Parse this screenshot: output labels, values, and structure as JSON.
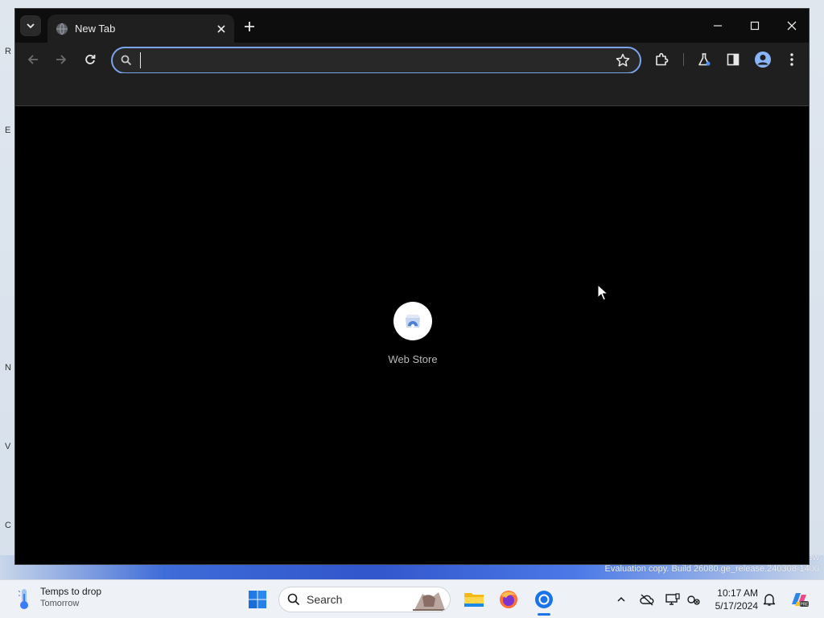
{
  "browser": {
    "tab": {
      "title": "New Tab"
    },
    "omnibox": {
      "value": "",
      "placeholder": ""
    },
    "shortcuts": [
      {
        "label": "Web Store"
      }
    ],
    "accent_color": "#7ba4ec"
  },
  "desktop": {
    "peek_letters": [
      "R",
      "E",
      "N",
      "V",
      "C"
    ],
    "watermark": "Evaluation copy. Build 26080.ge_release.240308-1400",
    "watermark_edge": "ew"
  },
  "taskbar": {
    "weather": {
      "line1": "Temps to drop",
      "line2": "Tomorrow"
    },
    "search_label": "Search",
    "clock": {
      "time": "10:17 AM",
      "date": "5/17/2024"
    },
    "active_indicator_color": "#1a73e8"
  }
}
